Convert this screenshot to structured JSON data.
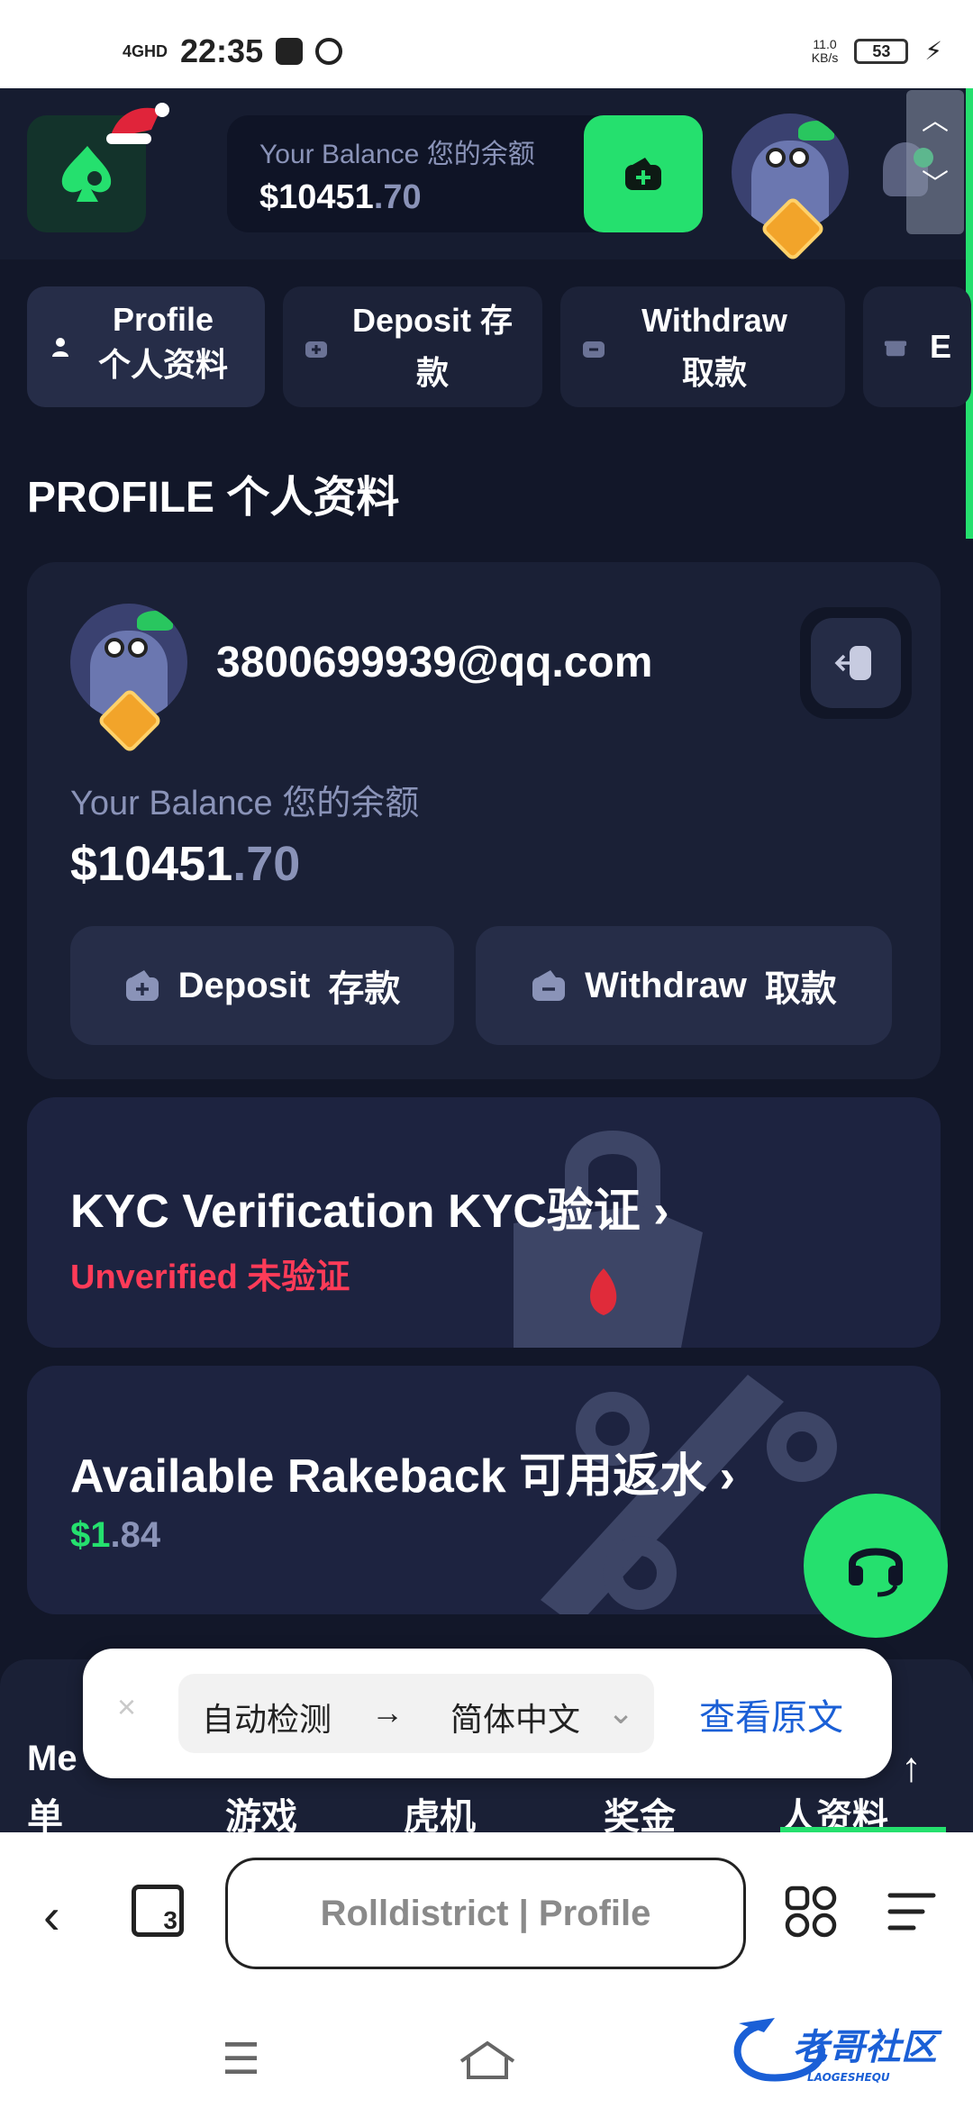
{
  "status_bar": {
    "network": "4GHD",
    "time": "22:35",
    "speed": "11.0",
    "speed_unit": "KB/s",
    "battery": "53"
  },
  "header": {
    "balance_label": "Your Balance 您的余额",
    "balance_main": "$10451",
    "balance_cents": ".70"
  },
  "tabs": [
    {
      "label": "Profile 个人资料",
      "icon": "user-icon"
    },
    {
      "label": "Deposit 存款",
      "icon": "wallet-plus-icon"
    },
    {
      "label": "Withdraw 取款",
      "icon": "wallet-minus-icon"
    },
    {
      "label": "E",
      "icon": "gift-icon"
    }
  ],
  "page_title": "PROFILE 个人资料",
  "profile_card": {
    "email": "3800699939@qq.com",
    "balance_label": "Your Balance 您的余额",
    "balance_main": "$10451",
    "balance_cents": ".70",
    "deposit_label": "Deposit",
    "deposit_cn": "存款",
    "withdraw_label": "Withdraw",
    "withdraw_cn": "取款"
  },
  "kyc": {
    "title": "KYC Verification KYC验证",
    "status": "Unverified 未验证"
  },
  "rakeback": {
    "title": "Available Rakeback 可用返水",
    "value_main": "$1",
    "value_cents": ".84"
  },
  "bottom_nav": {
    "items": [
      "Me",
      "单",
      "游戏",
      "虎机",
      "奖金",
      "人资料"
    ]
  },
  "translate_bar": {
    "close": "×",
    "source": "自动检测",
    "arrow": "→",
    "target": "简体中文",
    "view_original": "查看原文"
  },
  "browser": {
    "tab_count": "3",
    "url_title": "Rolldistrict | Profile"
  },
  "colors": {
    "accent": "#25e06e",
    "background": "#121729",
    "card": "#1a2036",
    "danger": "#ff3b58",
    "muted": "#8a93b8"
  }
}
